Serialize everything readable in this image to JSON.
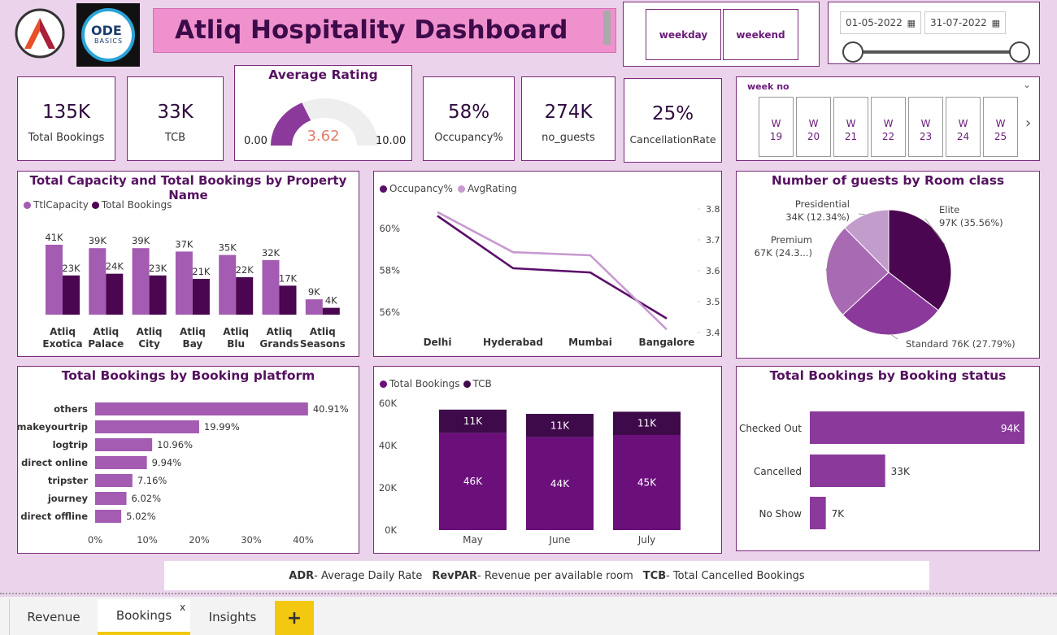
{
  "header": {
    "logo2_line1": "ODE",
    "logo2_line2": "BASICS",
    "title": "Atliq Hospitality Dashboard"
  },
  "filters": {
    "weekday_label": "weekday",
    "weekend_label": "weekend",
    "date_from": "01-05-2022",
    "date_to": "31-07-2022",
    "week_title": "week no",
    "weeks": [
      {
        "w": "W",
        "n": "19"
      },
      {
        "w": "W",
        "n": "20"
      },
      {
        "w": "W",
        "n": "21"
      },
      {
        "w": "W",
        "n": "22"
      },
      {
        "w": "W",
        "n": "23"
      },
      {
        "w": "W",
        "n": "24"
      },
      {
        "w": "W",
        "n": "25"
      }
    ]
  },
  "kpis": {
    "total_bookings": {
      "value": "135K",
      "label": "Total Bookings"
    },
    "tcb": {
      "value": "33K",
      "label": "TCB"
    },
    "occupancy": {
      "value": "58%",
      "label": "Occupancy%"
    },
    "guests": {
      "value": "274K",
      "label": "no_guests"
    },
    "cancellation": {
      "value": "25%",
      "label": "CancellationRate"
    }
  },
  "gauge": {
    "title": "Average Rating",
    "value": 3.62,
    "value_label": "3.62",
    "min_label": "0.00",
    "max_label": "10.00",
    "min": 0,
    "max": 10
  },
  "colors": {
    "dark_purple": "#4a0650",
    "mid_purple": "#a35cb1",
    "light_purple": "#c89ad0",
    "page_bg": "#ecd3ec",
    "gauge_fill": "#8b3a9b",
    "gauge_value": "#e07d6a",
    "accent_yellow": "#f2c811"
  },
  "charts": {
    "capacity": {
      "title": "Total Capacity and Total Bookings by Property Name"
    },
    "guests_pie": {
      "title": "Number of guests by Room class"
    },
    "platform": {
      "title": "Total Bookings by Booking platform"
    },
    "status": {
      "title": "Total Bookings by Booking status"
    }
  },
  "chart_data": [
    {
      "type": "bar",
      "title": "Total Capacity and Total Bookings by Property Name",
      "categories": [
        "Atliq Exotica",
        "Atliq Palace",
        "Atliq City",
        "Atliq Bay",
        "Atliq Blu",
        "Atliq Grands",
        "Atliq Seasons"
      ],
      "category_lines": [
        [
          "Atliq",
          "Exotica"
        ],
        [
          "Atliq",
          "Palace"
        ],
        [
          "Atliq",
          "City"
        ],
        [
          "Atliq",
          "Bay"
        ],
        [
          "Atliq",
          "Blu"
        ],
        [
          "Atliq",
          "Grands"
        ],
        [
          "Atliq",
          "Seasons"
        ]
      ],
      "series": [
        {
          "name": "TtlCapacity",
          "values": [
            41,
            39,
            39,
            37,
            35,
            32,
            9
          ],
          "labels": [
            "41K",
            "39K",
            "39K",
            "37K",
            "35K",
            "32K",
            "9K"
          ],
          "color": "#a35cb1"
        },
        {
          "name": "Total Bookings",
          "values": [
            23,
            24,
            23,
            21,
            22,
            17,
            4
          ],
          "labels": [
            "23K",
            "24K",
            "23K",
            "21K",
            "22K",
            "17K",
            "4K"
          ],
          "color": "#4a0650"
        }
      ],
      "unit": "K"
    },
    {
      "type": "line",
      "title": "",
      "categories": [
        "Delhi",
        "Hyderabad",
        "Mumbai",
        "Bangalore"
      ],
      "series": [
        {
          "name": "Occupancy%",
          "values": [
            60.6,
            58.1,
            57.9,
            55.7
          ],
          "axis": "left",
          "color": "#5a0d6a"
        },
        {
          "name": "AvgRating",
          "values": [
            3.79,
            3.66,
            3.65,
            3.41
          ],
          "axis": "right",
          "color": "#c89ad0"
        }
      ],
      "y_left": {
        "ticks": [
          "60%",
          "58%",
          "56%"
        ],
        "tick_values": [
          60,
          58,
          56
        ],
        "range": [
          55,
          62
        ]
      },
      "y_right": {
        "ticks": [
          "3.8",
          "3.7",
          "3.6",
          "3.5",
          "3.4"
        ],
        "tick_values": [
          3.8,
          3.7,
          3.6,
          3.5,
          3.4
        ],
        "range": [
          3.38,
          3.83
        ]
      }
    },
    {
      "type": "pie",
      "title": "Number of guests by Room class",
      "slices": [
        {
          "name": "Elite",
          "value": 97,
          "label": "97K (35.56%)",
          "color": "#4a0650"
        },
        {
          "name": "Standard",
          "value": 76,
          "label": "76K (27.79%)",
          "color": "#8b3a9b"
        },
        {
          "name": "Premium",
          "value": 67,
          "label": "67K (24.3...)",
          "color": "#a86ab3"
        },
        {
          "name": "Presidential",
          "value": 34,
          "label": "34K (12.34%)",
          "color": "#c29ccb"
        }
      ]
    },
    {
      "type": "bar",
      "orientation": "horizontal",
      "title": "Total Bookings by Booking platform",
      "categories": [
        "others",
        "makeyourtrip",
        "logtrip",
        "direct online",
        "tripster",
        "journey",
        "direct offline"
      ],
      "values": [
        40.91,
        19.99,
        10.96,
        9.94,
        7.16,
        6.02,
        5.02
      ],
      "labels": [
        "40.91%",
        "19.99%",
        "10.96%",
        "9.94%",
        "7.16%",
        "6.02%",
        "5.02%"
      ],
      "x_ticks": [
        "0%",
        "10%",
        "20%",
        "30%",
        "40%"
      ],
      "x_tick_values": [
        0,
        10,
        20,
        30,
        40
      ],
      "xlim": [
        0,
        42
      ]
    },
    {
      "type": "bar",
      "stacked": true,
      "title": "",
      "categories": [
        "May",
        "June",
        "July"
      ],
      "series": [
        {
          "name": "Total Bookings",
          "values": [
            46,
            44,
            45
          ],
          "labels": [
            "46K",
            "44K",
            "45K"
          ],
          "color": "#6b0f7a"
        },
        {
          "name": "TCB",
          "values": [
            11,
            11,
            11
          ],
          "labels": [
            "11K",
            "11K",
            "11K"
          ],
          "color": "#3f0a4a"
        }
      ],
      "y_ticks": [
        "60K",
        "40K",
        "20K",
        "0K"
      ],
      "y_tick_values": [
        60,
        40,
        20,
        0
      ],
      "ylim": [
        0,
        60
      ]
    },
    {
      "type": "bar",
      "orientation": "horizontal",
      "title": "Total Bookings by Booking status",
      "categories": [
        "Checked Out",
        "Cancelled",
        "No Show"
      ],
      "values": [
        94,
        33,
        7
      ],
      "labels": [
        "94K",
        "33K",
        "7K"
      ],
      "xlim": [
        0,
        94
      ]
    }
  ],
  "footer": {
    "adr_key": "ADR",
    "adr_text": "- Average Daily Rate",
    "revpar_key": "RevPAR",
    "revpar_text": " - Revenue per available room",
    "tcb_key": "TCB",
    "tcb_text": " - Total Cancelled Bookings"
  },
  "tabs": {
    "revenue": "Revenue",
    "bookings": "Bookings",
    "close": "x",
    "insights": "Insights",
    "add": "+"
  }
}
